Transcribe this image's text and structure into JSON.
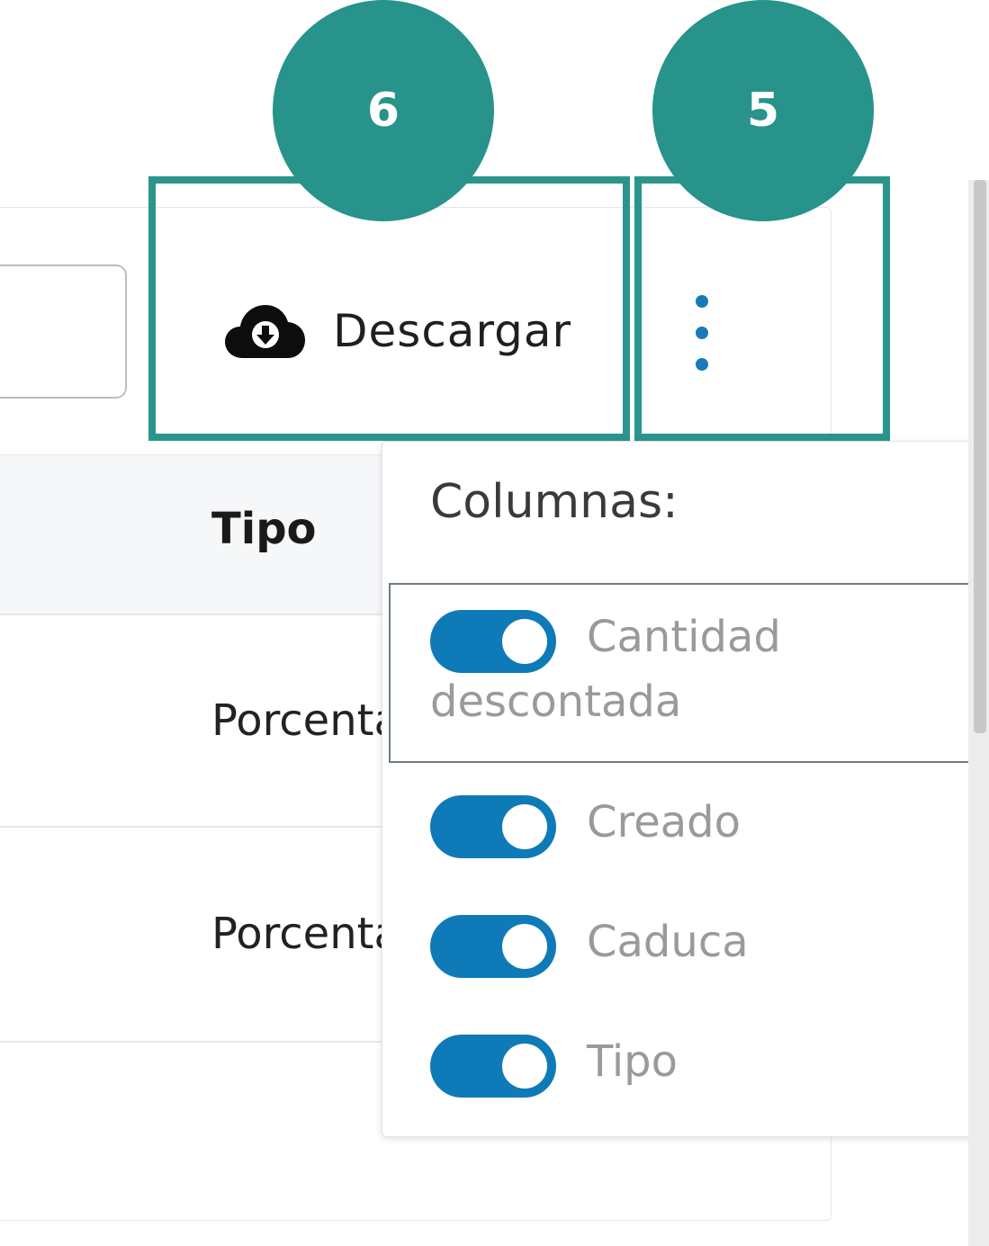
{
  "toolbar": {
    "download_label": "Descargar",
    "download_icon": "cloud-download-icon",
    "more_icon": "kebab-menu-icon"
  },
  "table": {
    "header_tipo": "Tipo",
    "rows": [
      {
        "tipo": "Porcentaje"
      },
      {
        "tipo": "Porcentaje"
      }
    ]
  },
  "annotations": [
    {
      "number": "6"
    },
    {
      "number": "5"
    }
  ],
  "columns_menu": {
    "title": "Columnas:",
    "items": [
      {
        "label_line1": "Cantidad",
        "label_line2": "descontada",
        "checked": true
      },
      {
        "label": "Creado",
        "checked": true
      },
      {
        "label": "Caduca",
        "checked": true
      },
      {
        "label": "Tipo",
        "checked": true
      }
    ]
  },
  "colors": {
    "accent": "#2b958c",
    "toggle": "#0f7ab8"
  }
}
